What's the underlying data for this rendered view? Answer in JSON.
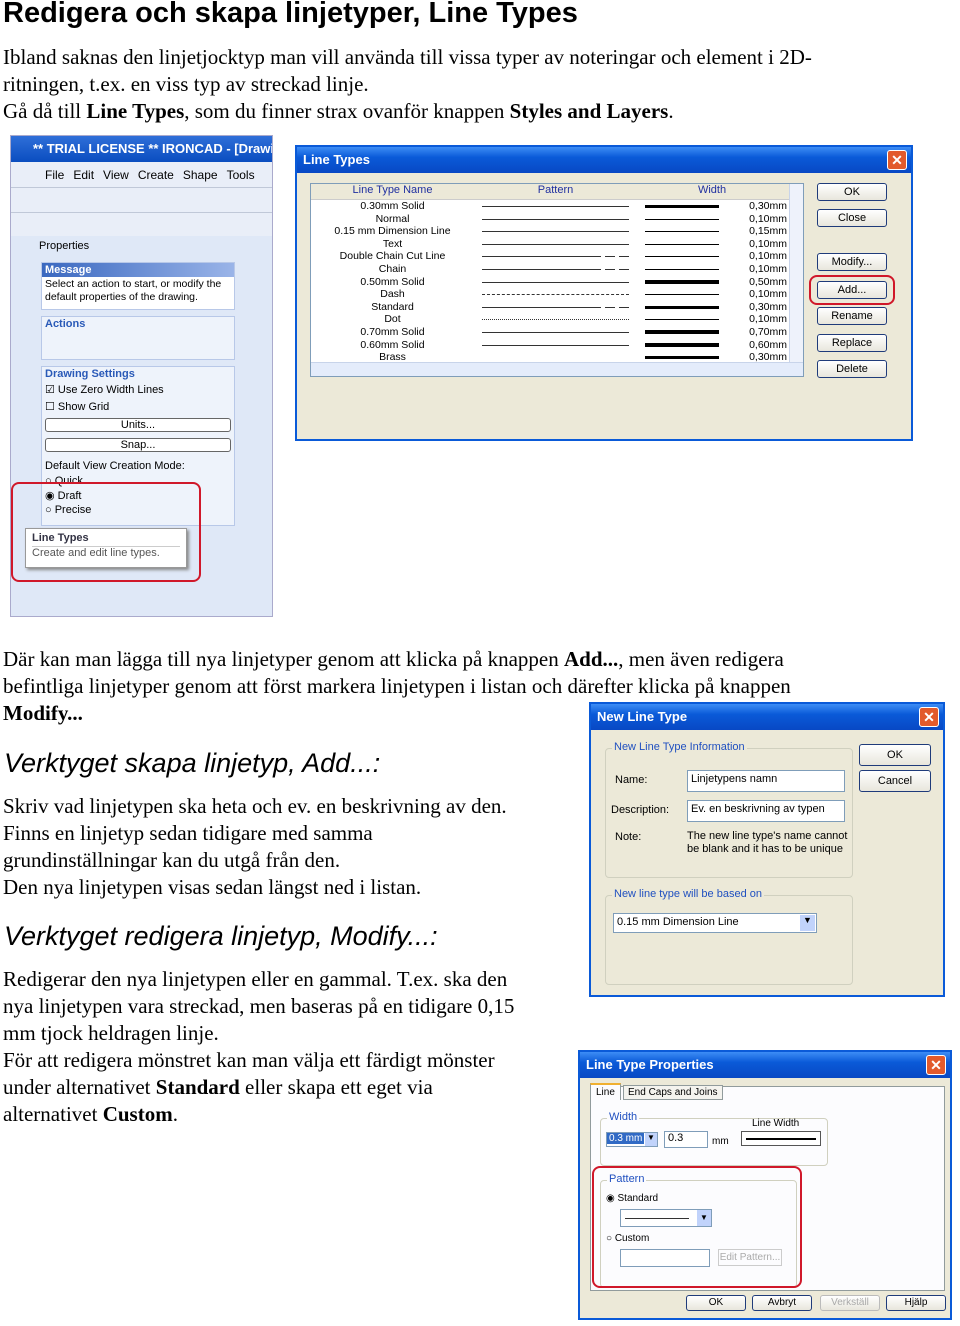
{
  "title": "Redigera och skapa linjetyper, Line Types",
  "intro": {
    "line1": "Ibland saknas den linjetjocktyp man vill använda till vissa typer av noteringar och element i 2D-",
    "line2": "ritningen, t.ex. en viss typ av streckad linje.",
    "line3_pre": "Gå då till ",
    "line3_b1": "Line Types",
    "line3_mid": ", som du finner strax ovanför knappen ",
    "line3_b2": "Styles and Layers",
    "line3_end": "."
  },
  "para2": {
    "l1_pre": "Där kan man lägga till nya linjetyper genom att klicka på knappen ",
    "l1_b": "Add...",
    "l1_end": ", men även redigera",
    "l2": "befintliga linjetyper genom att först markera linjetypen i listan och därefter klicka på knappen",
    "l3_b": "Modify..."
  },
  "heading_add": "Verktyget skapa linjetyp, Add...:",
  "para_add": [
    "Skriv vad linjetypen ska heta och ev. en beskrivning av den.",
    "Finns en linjetyp sedan tidigare med samma",
    "grundinställningar kan du utgå från den.",
    "Den nya linjetypen visas sedan längst ned i listan."
  ],
  "heading_modify": "Verktyget redigera linjetyp, Modify...:",
  "para_modify": {
    "l1": "Redigerar den nya linjetypen eller en gammal. T.ex. ska den",
    "l2": "nya linjetypen vara streckad, men baseras på en tidigare 0,15",
    "l3": "mm tjock heldragen linje.",
    "l4": "För att redigera mönstret kan man välja ett färdigt mönster",
    "l5_pre": "under alternativet ",
    "l5_b": "Standard",
    "l5_end": " eller skapa ett eget via",
    "l6_pre": "alternativet ",
    "l6_b": "Custom",
    "l6_end": "."
  },
  "ironcad": {
    "title": "** TRIAL LICENSE ** IRONCAD - [Drawin",
    "menu": [
      "File",
      "Edit",
      "View",
      "Create",
      "Shape",
      "Tools"
    ],
    "properties": "Properties",
    "message_h": "Message",
    "message": "Select an action to start, or modify the default properties of the drawing.",
    "actions_h": "Actions",
    "drawing_h": "Drawing Settings",
    "zero_width": "Use Zero Width Lines",
    "show_grid": "Show Grid",
    "units": "Units...",
    "snap": "Snap...",
    "mode_label": "Default View Creation Mode:",
    "modes": [
      "Quick",
      "Draft",
      "Precise"
    ],
    "tooltip_title": "Line Types",
    "tooltip_text": "Create and edit line types."
  },
  "line_types": {
    "title": "Line Types",
    "columns": [
      "Line Type Name",
      "Pattern",
      "Width"
    ],
    "rows": [
      {
        "name": "0.30mm Solid",
        "pattern": "solid",
        "width": "0,30mm"
      },
      {
        "name": "Normal",
        "pattern": "solid",
        "width": "0,10mm"
      },
      {
        "name": "0.15 mm Dimension Line",
        "pattern": "solid",
        "width": "0,15mm"
      },
      {
        "name": "Text",
        "pattern": "solid",
        "width": "0,10mm"
      },
      {
        "name": "Double Chain Cut Line",
        "pattern": "chain",
        "width": "0,10mm"
      },
      {
        "name": "Chain",
        "pattern": "chain",
        "width": "0,10mm"
      },
      {
        "name": "0.50mm Solid",
        "pattern": "solid",
        "width": "0,50mm"
      },
      {
        "name": "Dash",
        "pattern": "dash",
        "width": "0,10mm"
      },
      {
        "name": "Standard",
        "pattern": "chain",
        "width": "0,30mm"
      },
      {
        "name": "Dot",
        "pattern": "dot",
        "width": "0,10mm"
      },
      {
        "name": "0.70mm Solid",
        "pattern": "solid",
        "width": "0,70mm"
      },
      {
        "name": "0.60mm Solid",
        "pattern": "solid",
        "width": "0,60mm"
      },
      {
        "name": "Brass",
        "pattern": "none",
        "width": "0,30mm"
      }
    ],
    "buttons": [
      "OK",
      "Close",
      "Modify...",
      "Add...",
      "Rename",
      "Replace",
      "Delete"
    ]
  },
  "new_line_type": {
    "title": "New Line Type",
    "info_group": "New Line Type Information",
    "name_label": "Name:",
    "name_value": "Linjetypens namn",
    "desc_label": "Description:",
    "desc_value": "Ev. en beskrivning av typen",
    "note_label": "Note:",
    "note": "The new line type's name cannot be blank and it has to be unique",
    "based_group": "New line type will be based on",
    "based_value": "0.15 mm Dimension Line",
    "ok": "OK",
    "cancel": "Cancel"
  },
  "props": {
    "title": "Line Type Properties",
    "tabs": [
      "Line",
      "End Caps and Joins"
    ],
    "width_group": "Width",
    "width_select": "0.3 mm",
    "width_value": "0.3",
    "unit": "mm",
    "line_width": "Line Width",
    "pattern_group": "Pattern",
    "standard": "Standard",
    "custom": "Custom",
    "edit_pattern": "Edit Pattern...",
    "buttons": [
      "OK",
      "Avbryt",
      "Verkställ",
      "Hjälp"
    ]
  },
  "colors": {
    "xp_blue": "#0a5ad8",
    "highlight_red": "#d0182a",
    "dialog_bg": "#ece9d8",
    "panel_bg": "#c9d9f5"
  }
}
